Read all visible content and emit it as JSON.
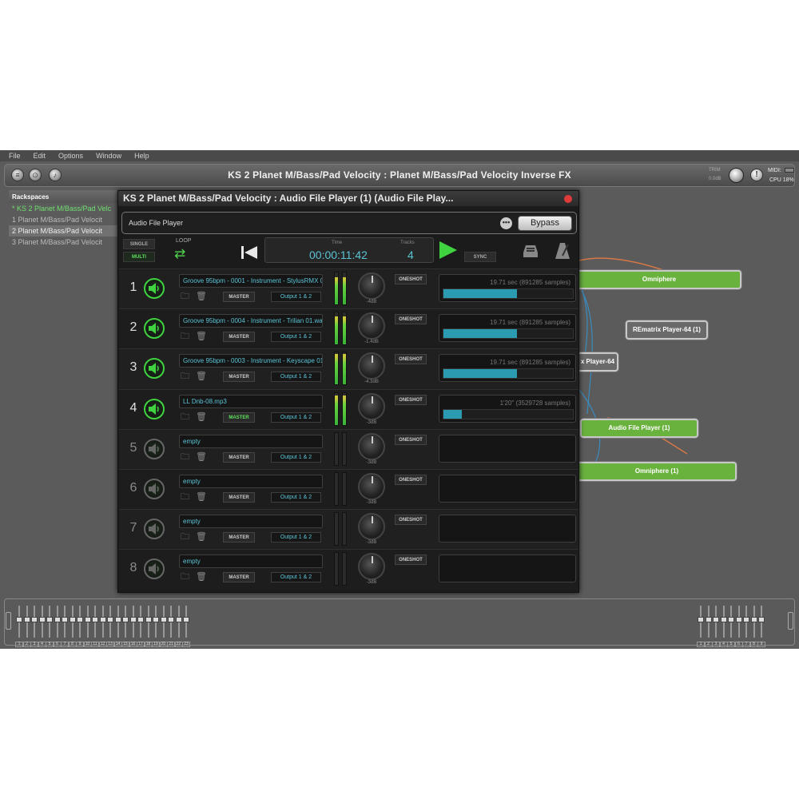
{
  "menu": [
    "File",
    "Edit",
    "Options",
    "Window",
    "Help"
  ],
  "titlebar": {
    "title": "KS 2 Planet M/Bass/Pad Velocity : Planet M/Bass/Pad Velocity Inverse FX",
    "trim_label": "TRIM",
    "trim_value": "0.0dB",
    "midi_label": "MIDI:",
    "cpu_label": "CPU  18%"
  },
  "rackspaces": {
    "header": "Rackspaces",
    "items": [
      {
        "label": "* KS 2 Planet M/Bass/Pad Velc",
        "state": "active"
      },
      {
        "label": "1  Planet M/Bass/Pad Velocit",
        "state": "normal"
      },
      {
        "label": "2  Planet M/Bass/Pad Velocit",
        "state": "selected"
      },
      {
        "label": "3  Planet M/Bass/Pad Velocit",
        "state": "normal"
      }
    ]
  },
  "graph": {
    "nodes": [
      "Omniphere",
      "REmatrix Player-64 (1)",
      "x Player-64",
      "Audio File Player (1)",
      "Omniphere (1)"
    ]
  },
  "plugin": {
    "title": "KS 2 Planet M/Bass/Pad Velocity : Audio File Player (1) (Audio File Play...",
    "name": "Audio File Player",
    "more_icon": "more-dots-icon",
    "bypass_label": "Bypass",
    "single_label": "SINGLE",
    "multi_label": "MULTI",
    "loop_label": "LOOP",
    "time_label": "Time",
    "time_value": "00:00:11:42",
    "tracks_label": "Tracks",
    "tracks_value": "4",
    "sync_label": "SYNC",
    "accent_color": "#3fd33f",
    "display_color": "#5bc3d6"
  },
  "tracks": [
    {
      "num": "1",
      "file": "Groove 95bpm - 0001 - Instrument - StylusRMX 01.wav",
      "master": "MASTER",
      "master_on": false,
      "output": "Output 1 & 2",
      "db": "-4dB",
      "oneshot": "ONESHOT",
      "duration": "19.71 sec (891285 samples)",
      "progress": 0.57,
      "meter_l": 0.85,
      "meter_r": 0.85,
      "empty": false
    },
    {
      "num": "2",
      "file": "Groove 95bpm - 0004 - Instrument - Trilian 01.wav",
      "master": "MASTER",
      "master_on": false,
      "output": "Output 1 & 2",
      "db": "-1.4dB",
      "oneshot": "ONESHOT",
      "duration": "19.71 sec (891285 samples)",
      "progress": 0.57,
      "meter_l": 0.88,
      "meter_r": 0.88,
      "empty": false
    },
    {
      "num": "3",
      "file": "Groove 95bpm - 0003 - Instrument - Keyscape 01.wav",
      "master": "MASTER",
      "master_on": false,
      "output": "Output 1 & 2",
      "db": "-4.3dB",
      "oneshot": "ONESHOT",
      "duration": "19.71 sec (891285 samples)",
      "progress": 0.57,
      "meter_l": 0.95,
      "meter_r": 0.95,
      "empty": false
    },
    {
      "num": "4",
      "file": "LL Dnb-08.mp3",
      "master": "MASTER",
      "master_on": true,
      "output": "Output 1 & 2",
      "db": "-3dB",
      "oneshot": "ONESHOT",
      "duration": "1'20\" (3529728 samples)",
      "progress": 0.14,
      "meter_l": 0.92,
      "meter_r": 0.92,
      "empty": false
    },
    {
      "num": "5",
      "file": "empty",
      "master": "MASTER",
      "master_on": false,
      "output": "Output 1 & 2",
      "db": "-3dB",
      "oneshot": "ONESHOT",
      "duration": "",
      "progress": 0,
      "meter_l": 0,
      "meter_r": 0,
      "empty": true
    },
    {
      "num": "6",
      "file": "empty",
      "master": "MASTER",
      "master_on": false,
      "output": "Output 1 & 2",
      "db": "-3dB",
      "oneshot": "ONESHOT",
      "duration": "",
      "progress": 0,
      "meter_l": 0,
      "meter_r": 0,
      "empty": true
    },
    {
      "num": "7",
      "file": "empty",
      "master": "MASTER",
      "master_on": false,
      "output": "Output 1 & 2",
      "db": "-3dB",
      "oneshot": "ONESHOT",
      "duration": "",
      "progress": 0,
      "meter_l": 0,
      "meter_r": 0,
      "empty": true
    },
    {
      "num": "8",
      "file": "empty",
      "master": "MASTER",
      "master_on": false,
      "output": "Output 1 & 2",
      "db": "-3dB",
      "oneshot": "ONESHOT",
      "duration": "",
      "progress": 0,
      "meter_l": 0,
      "meter_r": 0,
      "empty": true
    }
  ],
  "bottom": {
    "left_faders": [
      "1",
      "2",
      "3",
      "4",
      "5",
      "6",
      "7",
      "8",
      "9",
      "10",
      "11",
      "12",
      "13",
      "14",
      "15",
      "16",
      "17",
      "18",
      "19",
      "20",
      "21",
      "22",
      "23"
    ],
    "right_faders": [
      "1",
      "2",
      "3",
      "4",
      "5",
      "6",
      "7",
      "8",
      "9"
    ]
  }
}
